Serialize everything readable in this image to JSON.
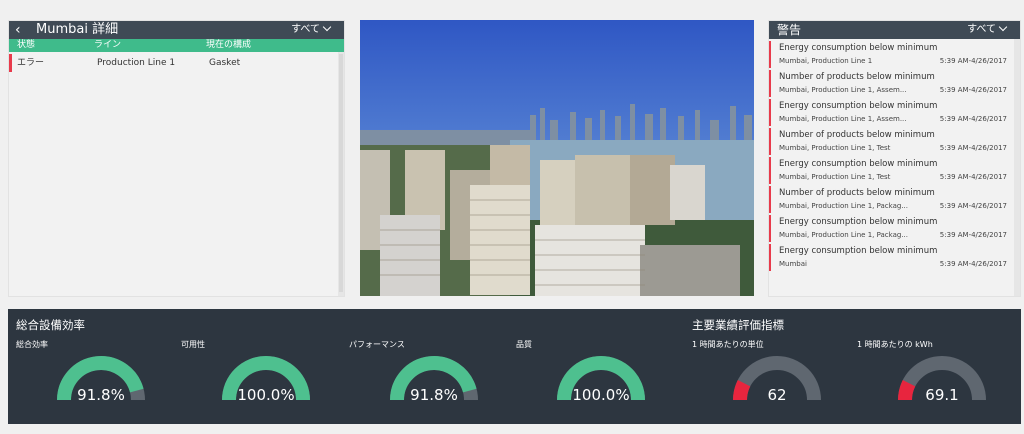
{
  "details": {
    "back_icon": "chevron-left-icon",
    "title": "Mumbai 詳細",
    "filter_label": "すべて",
    "columns": [
      "状態",
      "ライン",
      "現在の構成"
    ],
    "rows": [
      {
        "status": "エラー",
        "line": "Production Line 1",
        "config": "Gasket"
      }
    ]
  },
  "photo": {
    "subject": "Mumbai skyline"
  },
  "alerts": {
    "title": "警告",
    "filter_label": "すべて",
    "items": [
      {
        "message": "Energy consumption below minimum",
        "location": "Mumbai, Production Line 1",
        "time": "5:39 AM-4/26/2017"
      },
      {
        "message": "Number of products below minimum",
        "location": "Mumbai, Production Line 1, Assem...",
        "time": "5:39 AM-4/26/2017"
      },
      {
        "message": "Energy consumption below minimum",
        "location": "Mumbai, Production Line 1, Assem...",
        "time": "5:39 AM-4/26/2017"
      },
      {
        "message": "Number of products below minimum",
        "location": "Mumbai, Production Line 1, Test",
        "time": "5:39 AM-4/26/2017"
      },
      {
        "message": "Energy consumption below minimum",
        "location": "Mumbai, Production Line 1, Test",
        "time": "5:39 AM-4/26/2017"
      },
      {
        "message": "Number of products below minimum",
        "location": "Mumbai, Production Line 1, Packag...",
        "time": "5:39 AM-4/26/2017"
      },
      {
        "message": "Energy consumption below minimum",
        "location": "Mumbai, Production Line 1, Packag...",
        "time": "5:39 AM-4/26/2017"
      },
      {
        "message": "Energy consumption below minimum",
        "location": "Mumbai",
        "time": "5:39 AM-4/26/2017"
      }
    ]
  },
  "kpi": {
    "oee_title": "総合設備効率",
    "kpi_title": "主要業績評価指標",
    "gauges": [
      {
        "label": "総合効率",
        "value_text": "91.8%",
        "fraction": 0.918,
        "color": "#4ec08f"
      },
      {
        "label": "可用性",
        "value_text": "100.0%",
        "fraction": 1.0,
        "color": "#4ec08f"
      },
      {
        "label": "パフォーマンス",
        "value_text": "91.8%",
        "fraction": 0.918,
        "color": "#4ec08f"
      },
      {
        "label": "品質",
        "value_text": "100.0%",
        "fraction": 1.0,
        "color": "#4ec08f"
      },
      {
        "label": "1 時間あたりの単位",
        "value_text": "62",
        "fraction": 0.15,
        "color": "#e8253e"
      },
      {
        "label": "1 時間あたりの kWh",
        "value_text": "69.1",
        "fraction": 0.15,
        "color": "#e8253e"
      }
    ],
    "track_color": "#5f6770"
  }
}
